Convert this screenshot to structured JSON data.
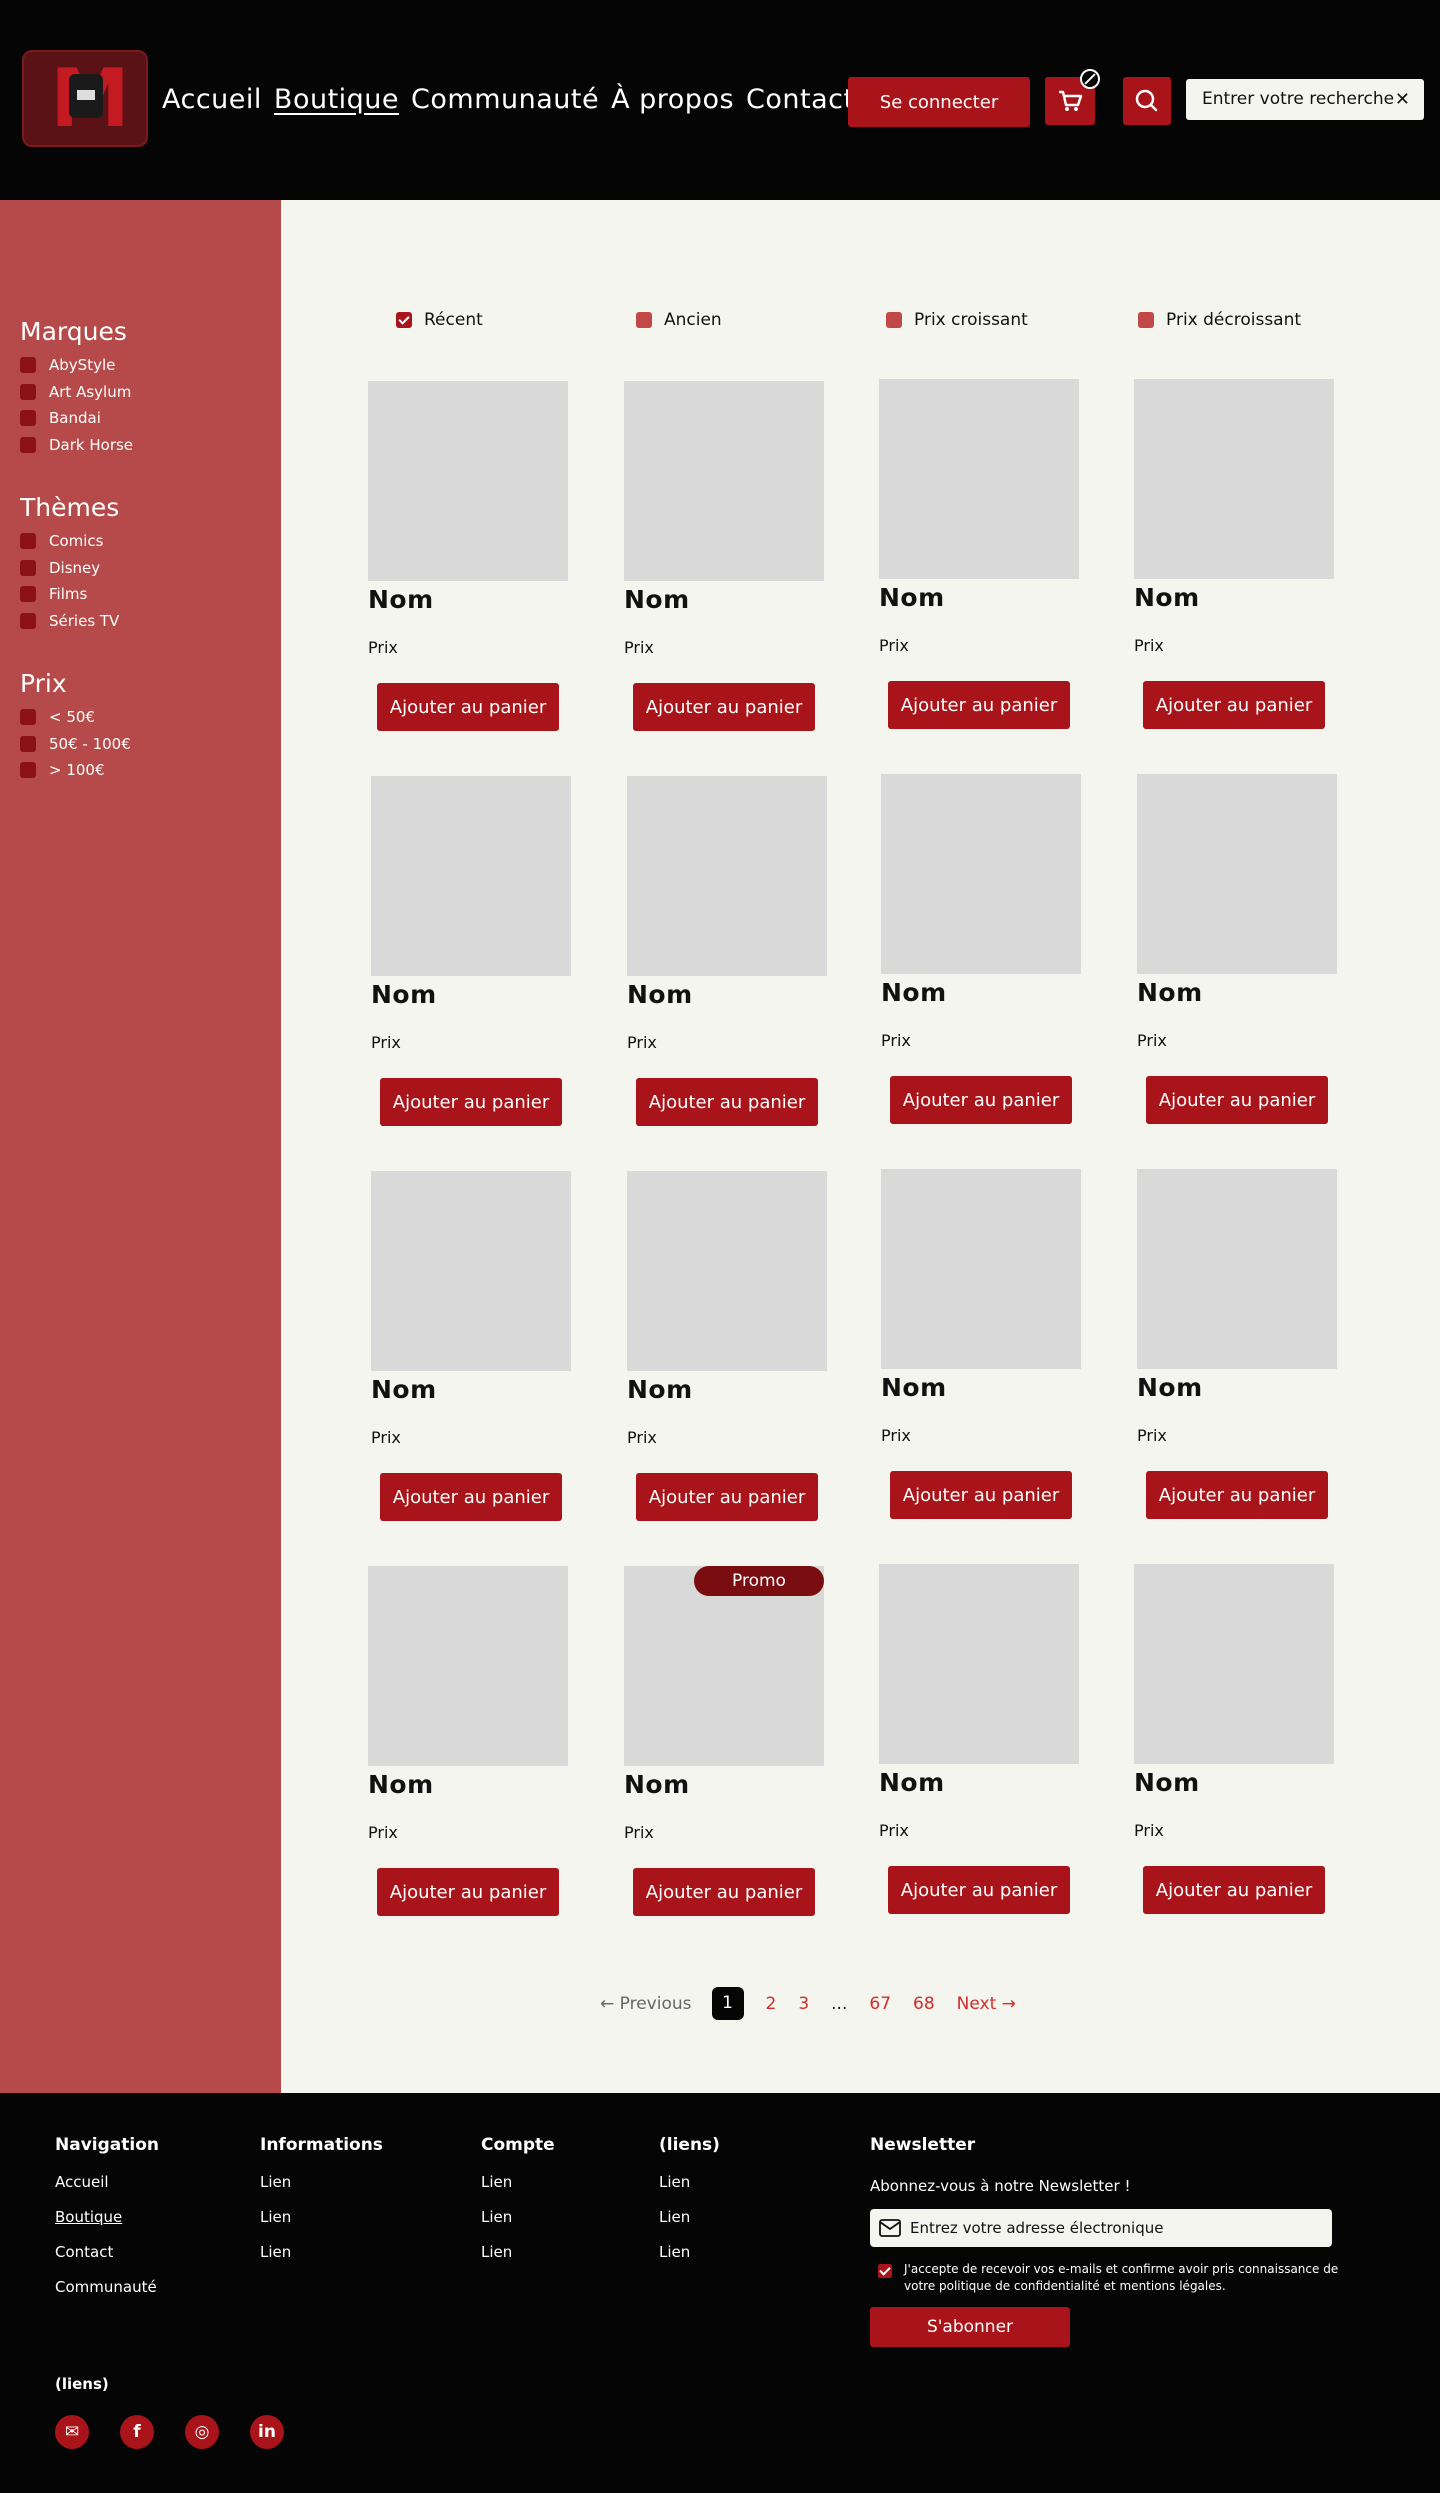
{
  "header": {
    "nav": [
      "Accueil",
      "Boutique",
      "Communauté",
      "À propos",
      "Contact"
    ],
    "active_nav": "Boutique",
    "login_label": "Se connecter",
    "search_placeholder": "Entrer votre recherche"
  },
  "colors": {
    "brand_red": "#a81419",
    "sidebar": "#b64949",
    "header_bg": "#050505",
    "page_bg": "#f5f5f0"
  },
  "filters": [
    {
      "title": "Marques",
      "options": [
        "AbyStyle",
        "Art Asylum",
        "Bandai",
        "Dark Horse"
      ]
    },
    {
      "title": "Thèmes",
      "options": [
        "Comics",
        "Disney",
        "Films",
        "Séries TV"
      ]
    },
    {
      "title": "Prix",
      "options": [
        "< 50€",
        "50€ - 100€",
        "> 100€"
      ]
    }
  ],
  "sorts": [
    {
      "label": "Récent",
      "checked": true
    },
    {
      "label": "Ancien",
      "checked": false
    },
    {
      "label": "Prix croissant",
      "checked": false
    },
    {
      "label": "Prix décroissant",
      "checked": false
    }
  ],
  "products": {
    "name": "Nom",
    "price": "Prix",
    "add_label": "Ajouter au panier",
    "promo_label": "Promo",
    "count": 16
  },
  "pagination": {
    "prev": "Previous",
    "next": "Next",
    "pages": [
      "1",
      "2",
      "3",
      "...",
      "67",
      "68"
    ],
    "current": "1"
  },
  "footer": {
    "columns": [
      {
        "title": "Navigation",
        "links": [
          "Accueil",
          "Boutique",
          "Contact",
          "Communauté"
        ]
      },
      {
        "title": "Informations",
        "links": [
          "Lien",
          "Lien",
          "Lien"
        ]
      },
      {
        "title": "Compte",
        "links": [
          "Lien",
          "Lien",
          "Lien"
        ]
      },
      {
        "title": "(liens)",
        "links": [
          "Lien",
          "Lien",
          "Lien"
        ]
      }
    ],
    "newsletter": {
      "title": "Newsletter",
      "subtitle": "Abonnez-vous à notre Newsletter !",
      "email_placeholder": "Entrez votre adresse électronique",
      "consent": "J'accepte de recevoir vos e-mails et confirme avoir pris connaissance de votre politique de confidentialité et mentions légales.",
      "subscribe_label": "S'abonner"
    },
    "social_title": "(liens)",
    "social_icons": [
      "mail-icon",
      "facebook-icon",
      "instagram-icon",
      "linkedin-icon"
    ]
  }
}
